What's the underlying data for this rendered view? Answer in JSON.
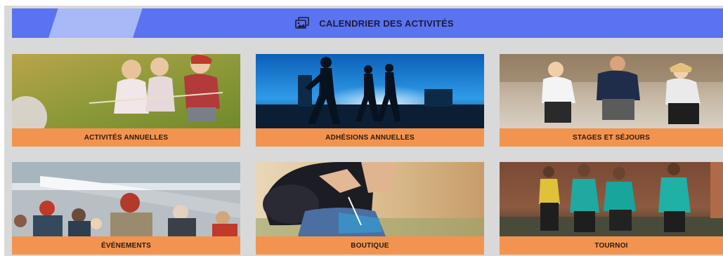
{
  "header": {
    "title": "CALENDRIER DES ACTIVITÉS",
    "icon": "photos-icon",
    "color": "#5a73f0"
  },
  "cards": [
    {
      "label": "ACTIVITÉS ANNUELLES",
      "image": "children-tug-of-war-photo"
    },
    {
      "label": "ADHÉSIONS ANNUELLES",
      "image": "runners-silhouette-photo"
    },
    {
      "label": "STAGES ET SÉJOURS",
      "image": "group-workout-photo"
    },
    {
      "label": "ÉVÉNEMENTS",
      "image": "crowd-winter-event-photo"
    },
    {
      "label": "BOUTIQUE",
      "image": "lacing-running-shoe-photo"
    },
    {
      "label": "TOURNOI",
      "image": "football-team-photo"
    }
  ],
  "colors": {
    "label_bg": "#f2944f",
    "background": "#d9d9d9"
  }
}
